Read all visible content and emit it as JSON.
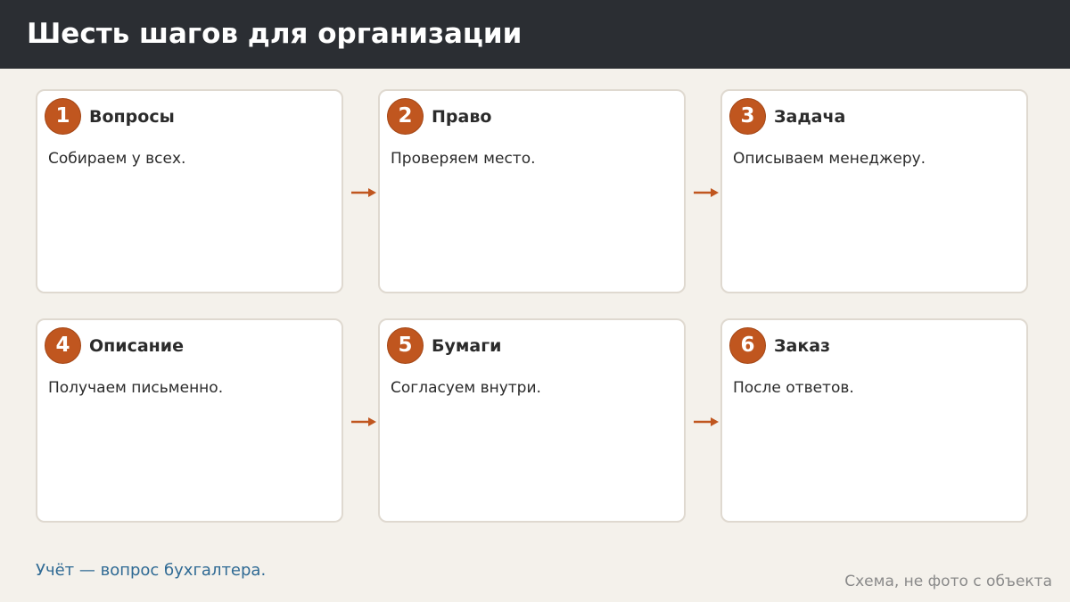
{
  "header": {
    "title": "Шесть шагов для организации"
  },
  "steps": [
    {
      "number": "1",
      "title": "Вопросы",
      "text": "Собираем у всех."
    },
    {
      "number": "2",
      "title": "Право",
      "text": "Проверяем место."
    },
    {
      "number": "3",
      "title": "Задача",
      "text": "Описываем менеджеру."
    },
    {
      "number": "4",
      "title": "Описание",
      "text": "Получаем письменно."
    },
    {
      "number": "5",
      "title": "Бумаги",
      "text": "Согласуем внутри."
    },
    {
      "number": "6",
      "title": "Заказ",
      "text": "После ответов."
    }
  ],
  "footer": {
    "note": "Учёт — вопрос бухгалтера.",
    "caption": "Схема, не фото с объекта"
  },
  "colors": {
    "header_bg": "#2b2e33",
    "background": "#f4f1eb",
    "accent": "#c0561f",
    "note_text": "#2f6a94"
  }
}
